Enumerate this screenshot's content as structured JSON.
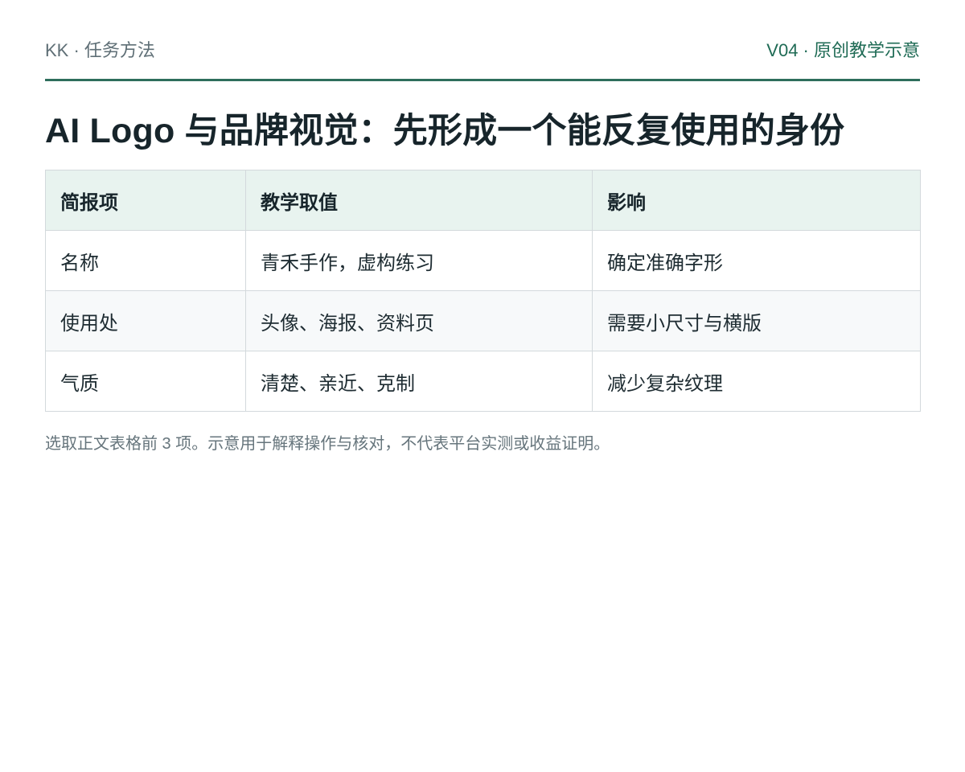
{
  "header": {
    "left": "KK · 任务方法",
    "right": "V04 · 原创教学示意"
  },
  "title": "AI Logo 与品牌视觉：先形成一个能反复使用的身份",
  "table": {
    "headers": [
      "简报项",
      "教学取值",
      "影响"
    ],
    "rows": [
      [
        "名称",
        "青禾手作，虚构练习",
        "确定准确字形"
      ],
      [
        "使用处",
        "头像、海报、资料页",
        "需要小尺寸与横版"
      ],
      [
        "气质",
        "清楚、亲近、克制",
        "减少复杂纹理"
      ]
    ]
  },
  "footnote": "选取正文表格前 3 项。示意用于解释操作与核对，不代表平台实测或收益证明。",
  "colors": {
    "accent": "#2e6e5c",
    "header_row_bg": "#e8f3ef",
    "border": "#d3d9dc"
  }
}
